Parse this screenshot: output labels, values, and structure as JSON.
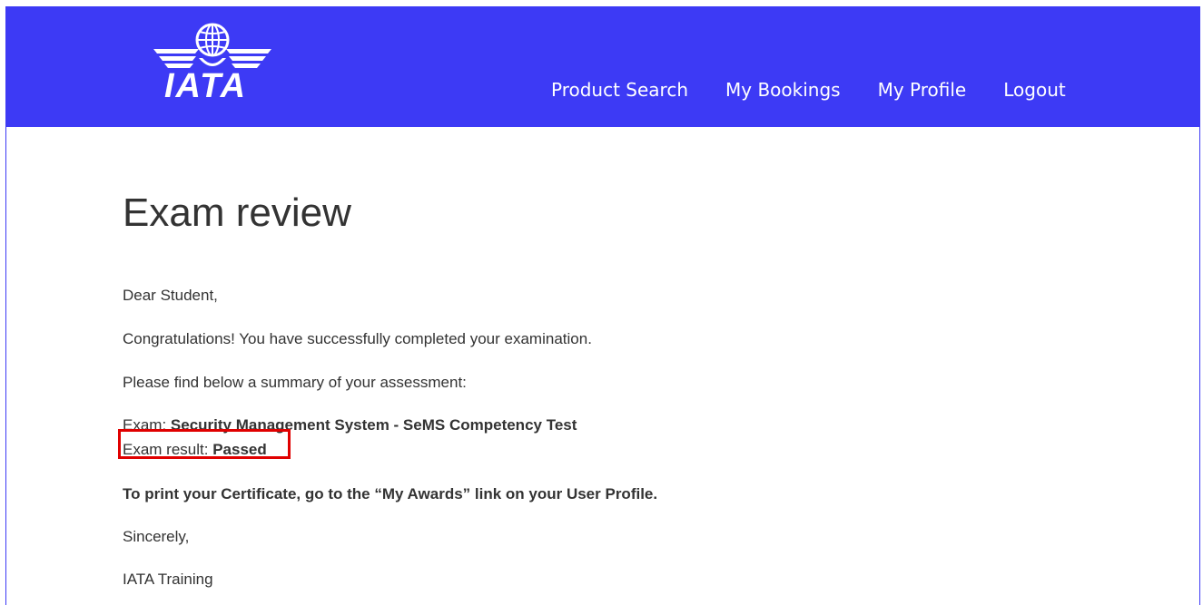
{
  "brand": {
    "name": "IATA",
    "color": "#3d3af5",
    "logo_icon": "iata-globe-wings-logo"
  },
  "nav": {
    "items": [
      {
        "label": "Product Search"
      },
      {
        "label": "My Bookings"
      },
      {
        "label": "My Profile"
      },
      {
        "label": "Logout"
      }
    ]
  },
  "main": {
    "title": "Exam review",
    "greeting": "Dear Student,",
    "congrats": "Congratulations!  You have successfully completed your examination.",
    "summary_intro": "Please find below a summary of your assessment:",
    "exam_label": "Exam: ",
    "exam_name": "Security Management System - SeMS Competency Test",
    "result_label": "Exam result: ",
    "result_value": "Passed",
    "certificate_note": "To print your Certificate, go to the “My Awards” link on your User Profile.",
    "closing": "Sincerely,",
    "signature": "IATA Training"
  },
  "highlight_color": "#e00000"
}
